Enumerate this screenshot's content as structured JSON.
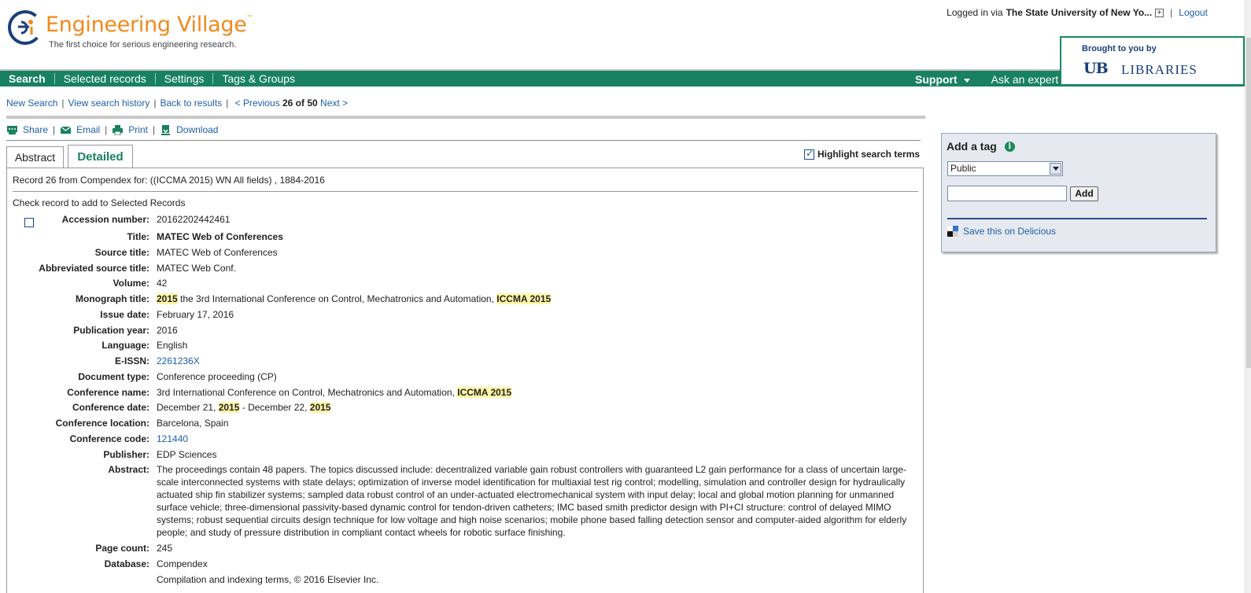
{
  "header": {
    "logo_title": "Engineering Village",
    "logo_tm": "™",
    "tagline": "The first choice for serious engineering research.",
    "login_prefix": "Logged in via",
    "login_institution": "The State University of New Yo...",
    "logout": "Logout",
    "brought_by": "Brought to you by",
    "brought_ub": "UB",
    "brought_libraries": "LIBRARIES"
  },
  "nav": {
    "items": [
      "Search",
      "Selected records",
      "Settings",
      "Tags & Groups"
    ],
    "support": "Support",
    "ask": "Ask an expert"
  },
  "crumbs": {
    "new_search": "New Search",
    "history": "View search history",
    "back": "Back to results",
    "previous": "< Previous",
    "position": "26 of 50",
    "next": "Next >"
  },
  "toolbar": {
    "share": "Share",
    "email": "Email",
    "print": "Print",
    "download": "Download"
  },
  "tabs": {
    "abstract": "Abstract",
    "detailed": "Detailed"
  },
  "highlight": "Highlight search terms",
  "record_line": "Record 26 from Compendex for: ((ICCMA 2015) WN All fields) , 1884-2016",
  "check_text": "Check record to add to Selected Records",
  "fields": {
    "accession_label": "Accession number:",
    "accession": "20162202442461",
    "title_label": "Title:",
    "title": "MATEC Web of Conferences",
    "source_label": "Source title:",
    "source": "MATEC Web of Conferences",
    "abbrev_label": "Abbreviated source title:",
    "abbrev": "MATEC Web Conf.",
    "volume_label": "Volume:",
    "volume": "42",
    "monograph_label": "Monograph title:",
    "monograph_hl1": "2015",
    "monograph_mid": " the 3rd International Conference on Control, Mechatronics and Automation, ",
    "monograph_hl2": "ICCMA 2015",
    "issue_label": "Issue date:",
    "issue": "February 17, 2016",
    "pubyear_label": "Publication year:",
    "pubyear": "2016",
    "language_label": "Language:",
    "language": "English",
    "eissn_label": "E-ISSN:",
    "eissn": "2261236X",
    "doctype_label": "Document type:",
    "doctype": "Conference proceeding (CP)",
    "confname_label": "Conference name:",
    "confname": "3rd International Conference on Control, Mechatronics and Automation, ",
    "confname_hl": "ICCMA 2015",
    "confdate_label": "Conference date:",
    "confdate_a": "December 21, ",
    "confdate_hl1": "2015",
    "confdate_b": " - December 22, ",
    "confdate_hl2": "2015",
    "conflocation_label": "Conference location:",
    "conflocation": "Barcelona, Spain",
    "confcode_label": "Conference code:",
    "confcode": "121440",
    "publisher_label": "Publisher:",
    "publisher": "EDP Sciences",
    "abstract_label": "Abstract:",
    "abstract": "The proceedings contain 48 papers. The topics discussed include: decentralized variable gain robust controllers with guaranteed L2 gain performance for a class of uncertain large-scale interconnected systems with state delays; optimization of inverse model identification for multiaxial test rig control; modelling, simulation and controller design for hydraulically actuated ship fin stabilizer systems; sampled data robust control of an under-actuated electromechanical system with input delay; local and global motion planning for unmanned surface vehicle; three-dimensional passivity-based dynamic control for tendon-driven catheters; IMC based smith predictor design with PI+CI structure: control of delayed MIMO systems; robust sequential circuits design technique for low voltage and high noise scenarios; mobile phone based falling detection sensor and computer-aided algorithm for elderly people; and study of pressure distribution in compliant contact wheels for robotic surface finishing.",
    "pagecount_label": "Page count:",
    "pagecount": "245",
    "database_label": "Database:",
    "database": "Compendex",
    "copyright": "Compilation and indexing terms, © 2016 Elsevier Inc."
  },
  "sidebar": {
    "add_tag": "Add a tag",
    "info": "i",
    "visibility": "Public",
    "add": "Add",
    "delicious": "Save this on Delicious"
  },
  "colors": {
    "brand_green": "#188161",
    "logo_orange": "#f08a1c",
    "link_blue": "#1f5fa8",
    "highlight": "#fff6a8"
  }
}
